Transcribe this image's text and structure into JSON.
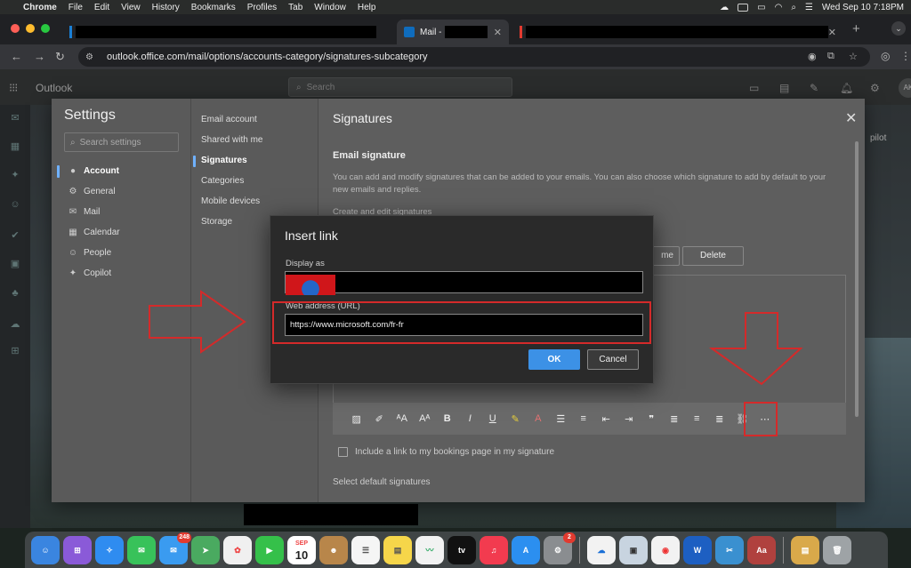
{
  "menubar": {
    "app": "Chrome",
    "items": [
      "File",
      "Edit",
      "View",
      "History",
      "Bookmarks",
      "Profiles",
      "Tab",
      "Window",
      "Help"
    ],
    "datetime": "Wed Sep 10  7:18PM"
  },
  "browser": {
    "active_tab_label": "Mail -",
    "url": "outlook.office.com/mail/options/accounts-category/signatures-subcategory"
  },
  "outlook": {
    "brand": "Outlook",
    "search_placeholder": "Search",
    "avatar_initials": "AK"
  },
  "settings": {
    "title": "Settings",
    "search_placeholder": "Search settings",
    "categories": [
      {
        "label": "Account",
        "icon": "person-icon"
      },
      {
        "label": "General",
        "icon": "gear-icon"
      },
      {
        "label": "Mail",
        "icon": "mail-icon"
      },
      {
        "label": "Calendar",
        "icon": "calendar-icon"
      },
      {
        "label": "People",
        "icon": "people-icon"
      },
      {
        "label": "Copilot",
        "icon": "copilot-icon"
      }
    ],
    "subcategories": [
      "Email account",
      "Shared with me",
      "Signatures",
      "Categories",
      "Mobile devices",
      "Storage"
    ],
    "panel": {
      "title": "Signatures",
      "section_title": "Email signature",
      "description": "You can add and modify signatures that can be added to your emails. You can also choose which signature to add by default to your new emails and replies.",
      "create_edit_label": "Create and edit signatures",
      "rename_label": "me",
      "delete_label": "Delete",
      "bookings_label": "Include a link to my bookings page in my signature",
      "default_sig_label": "Select default signatures"
    }
  },
  "dialog": {
    "title": "Insert link",
    "display_as_label": "Display as",
    "url_label": "Web address (URL)",
    "url_value": "https://www.microsoft.com/fr-fr",
    "ok_label": "OK",
    "cancel_label": "Cancel"
  },
  "copilot_fragment": "pilot",
  "dock": {
    "mail_badge": "248",
    "calendar_month": "SEP",
    "calendar_day": "10",
    "settings_badge": "2",
    "appletv_label": "tv"
  },
  "colors": {
    "accent": "#3c91e6",
    "annotation": "#d42a2a"
  }
}
